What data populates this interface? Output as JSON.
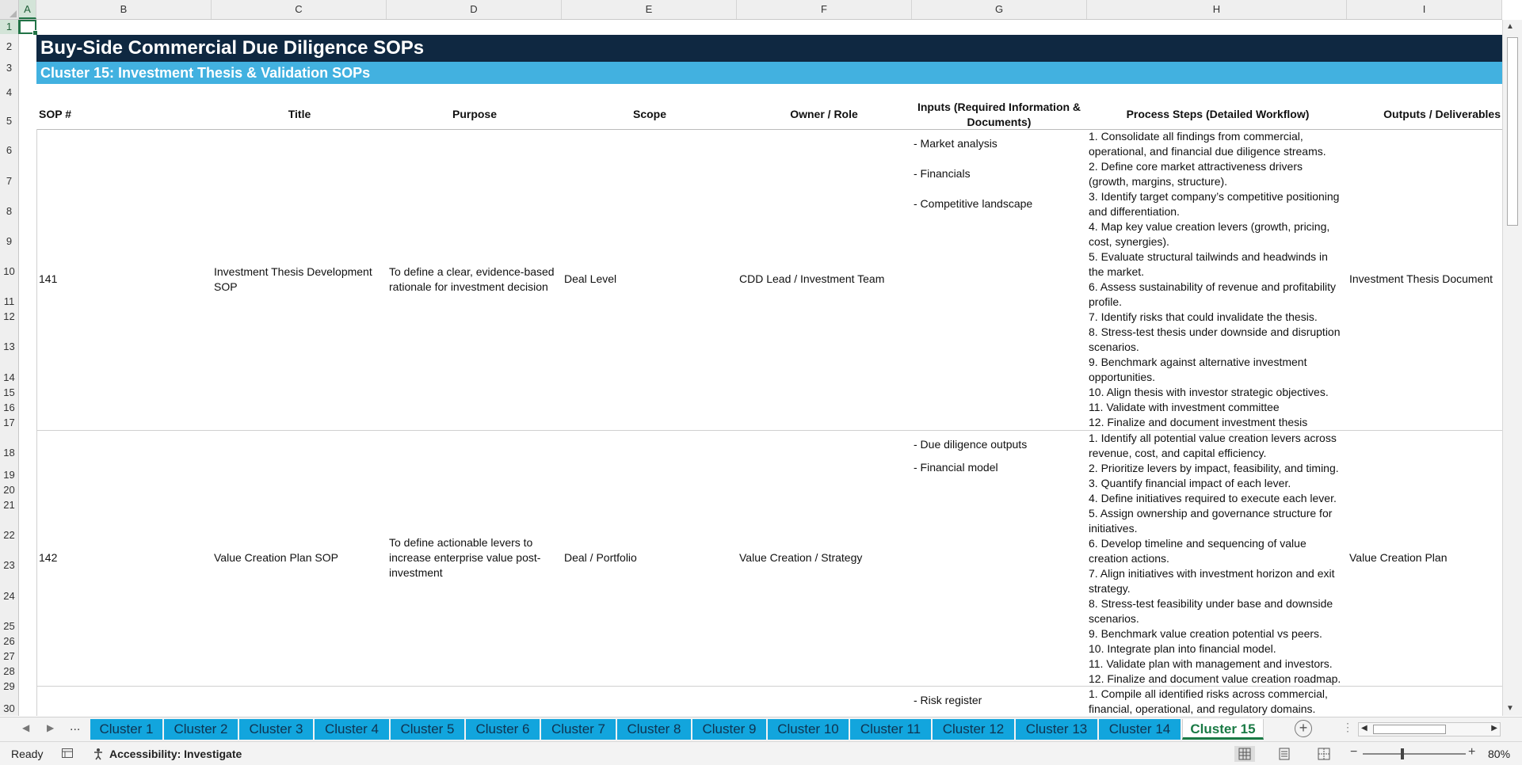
{
  "columns": [
    "A",
    "B",
    "C",
    "D",
    "E",
    "F",
    "G",
    "H",
    "I"
  ],
  "rows": [
    "1",
    "2",
    "3",
    "4",
    "5",
    "6",
    "7",
    "8",
    "9",
    "10",
    "11",
    "12",
    "13",
    "14",
    "15",
    "16",
    "17",
    "18",
    "19",
    "20",
    "21",
    "22",
    "23",
    "24",
    "25",
    "26",
    "27",
    "28",
    "29",
    "30"
  ],
  "sheet": {
    "title": "Buy-Side Commercial Due Diligence SOPs",
    "subtitle": "Cluster 15: Investment Thesis & Validation SOPs",
    "headers": {
      "sop": "SOP #",
      "title": "Title",
      "purpose": "Purpose",
      "scope": "Scope",
      "owner": "Owner / Role",
      "inputs": "Inputs (Required Information & Documents)",
      "steps": "Process Steps (Detailed Workflow)",
      "outputs": "Outputs / Deliverables"
    },
    "records": [
      {
        "sop": "141",
        "title": "Investment Thesis Development SOP",
        "purpose": "To define a clear, evidence-based rationale for investment decision",
        "scope": "Deal Level",
        "owner": "CDD Lead / Investment Team",
        "inputs": [
          "- Market analysis",
          "- Financials",
          "- Competitive landscape"
        ],
        "steps": [
          "1. Consolidate all findings from commercial, operational, and financial due diligence streams.",
          "2. Define core market attractiveness drivers (growth, margins, structure).",
          "3. Identify target company’s competitive positioning and differentiation.",
          "4. Map key value creation levers (growth, pricing, cost, synergies).",
          "5. Evaluate structural tailwinds and headwinds in the market.",
          "6. Assess sustainability of revenue and profitability profile.",
          "7. Identify risks that could invalidate the thesis.",
          "8. Stress-test thesis under downside and disruption scenarios.",
          "9. Benchmark against alternative investment opportunities.",
          "10. Align thesis with investor strategic objectives.",
          "11. Validate with investment committee",
          "12. Finalize and document investment thesis"
        ],
        "outputs": "Investment Thesis Document"
      },
      {
        "sop": "142",
        "title": "Value Creation Plan SOP",
        "purpose": "To define actionable levers to increase enterprise value post-investment",
        "scope": "Deal / Portfolio",
        "owner": "Value Creation / Strategy",
        "inputs": [
          "- Due diligence outputs",
          "- Financial model"
        ],
        "steps": [
          "1. Identify all potential value creation levers across revenue, cost, and capital efficiency.",
          "2. Prioritize levers by impact, feasibility, and timing.",
          "3. Quantify financial impact of each lever.",
          "4. Define initiatives required to execute each lever.",
          "5. Assign ownership and governance structure for initiatives.",
          "6. Develop timeline and sequencing of value creation actions.",
          "7. Align initiatives with investment horizon and exit strategy.",
          "8. Stress-test feasibility under base and downside scenarios.",
          "9. Benchmark value creation potential vs peers.",
          "10. Integrate plan into financial model.",
          "11. Validate plan with management and investors.",
          "12. Finalize and document value creation roadmap."
        ],
        "outputs": "Value Creation Plan"
      },
      {
        "inputs": [
          "- Risk register"
        ],
        "steps": [
          "1. Compile all identified risks across commercial, financial, operational, and regulatory domains."
        ]
      }
    ]
  },
  "tabs": {
    "ellipsis": "...",
    "items": [
      "Cluster 1",
      "Cluster 2",
      "Cluster 3",
      "Cluster 4",
      "Cluster 5",
      "Cluster 6",
      "Cluster 7",
      "Cluster 8",
      "Cluster 9",
      "Cluster 10",
      "Cluster 11",
      "Cluster 12",
      "Cluster 13",
      "Cluster 14",
      "Cluster 15"
    ],
    "active": "Cluster 15"
  },
  "status": {
    "ready": "Ready",
    "accessibility": "Accessibility: Investigate",
    "zoom": "80%"
  },
  "colors": {
    "title_band": "#0f2841",
    "subtitle_band": "#42b1e0",
    "tab": "#12a5dd",
    "active_tab_text": "#1a7a45"
  }
}
